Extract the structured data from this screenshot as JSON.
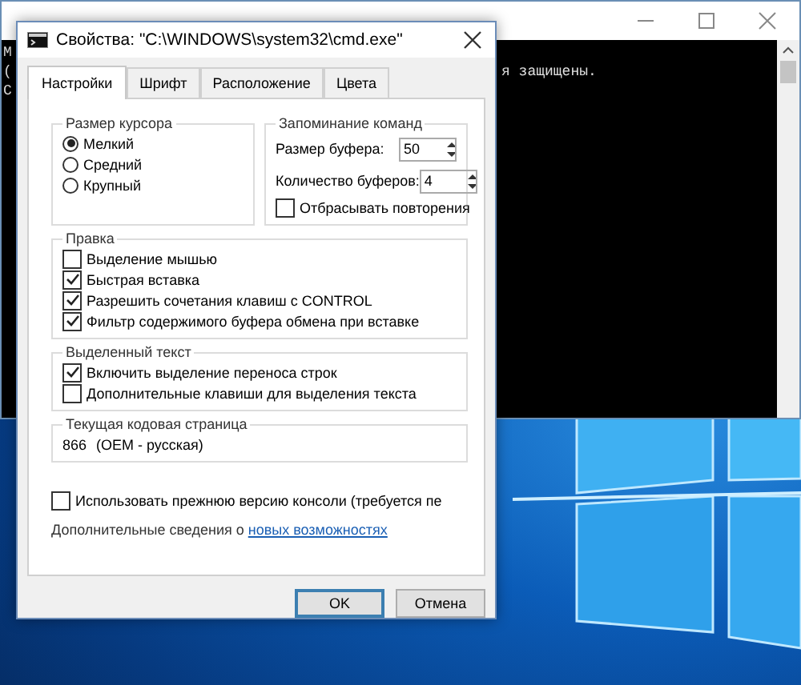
{
  "console": {
    "lines": [
      {
        "left": "M"
      },
      {
        "left": "(",
        "right": "я защищены."
      },
      {
        "left": "C"
      }
    ]
  },
  "dialog": {
    "title": "Свойства: \"C:\\WINDOWS\\system32\\cmd.exe\"",
    "tabs": [
      {
        "label": "Настройки",
        "selected": true
      },
      {
        "label": "Шрифт",
        "selected": false
      },
      {
        "label": "Расположение",
        "selected": false
      },
      {
        "label": "Цвета",
        "selected": false
      }
    ],
    "cursor_size": {
      "title": "Размер курсора",
      "options": [
        {
          "label": "Мелкий",
          "selected": true
        },
        {
          "label": "Средний",
          "selected": false
        },
        {
          "label": "Крупный",
          "selected": false
        }
      ]
    },
    "history": {
      "title": "Запоминание команд",
      "fields": [
        {
          "label": "Размер буфера:",
          "value": "50"
        },
        {
          "label": "Количество буферов:",
          "value": "4"
        }
      ],
      "discard": {
        "label": "Отбрасывать повторения",
        "checked": false
      }
    },
    "edit": {
      "title": "Правка",
      "options": [
        {
          "label": "Выделение мышью",
          "checked": false
        },
        {
          "label": "Быстрая вставка",
          "checked": true
        },
        {
          "label": "Разрешить сочетания клавиш с CONTROL",
          "checked": true
        },
        {
          "label": "Фильтр содержимого буфера обмена при вставке",
          "checked": true
        }
      ]
    },
    "selected_text": {
      "title": "Выделенный текст",
      "options": [
        {
          "label": "Включить выделение переноса строк",
          "checked": true
        },
        {
          "label": "Дополнительные клавиши для выделения текста",
          "checked": false
        }
      ]
    },
    "code_page": {
      "title": "Текущая кодовая страница",
      "number": "866",
      "name": "(OEM - русская)"
    },
    "legacy": {
      "label": "Использовать прежнюю версию консоли (требуется пе",
      "checked": false
    },
    "info": {
      "text": "Дополнительные сведения о ",
      "link": "новых возможностях"
    },
    "buttons": [
      {
        "label": "OK",
        "default": true
      },
      {
        "label": "Отмена",
        "default": false
      }
    ]
  }
}
